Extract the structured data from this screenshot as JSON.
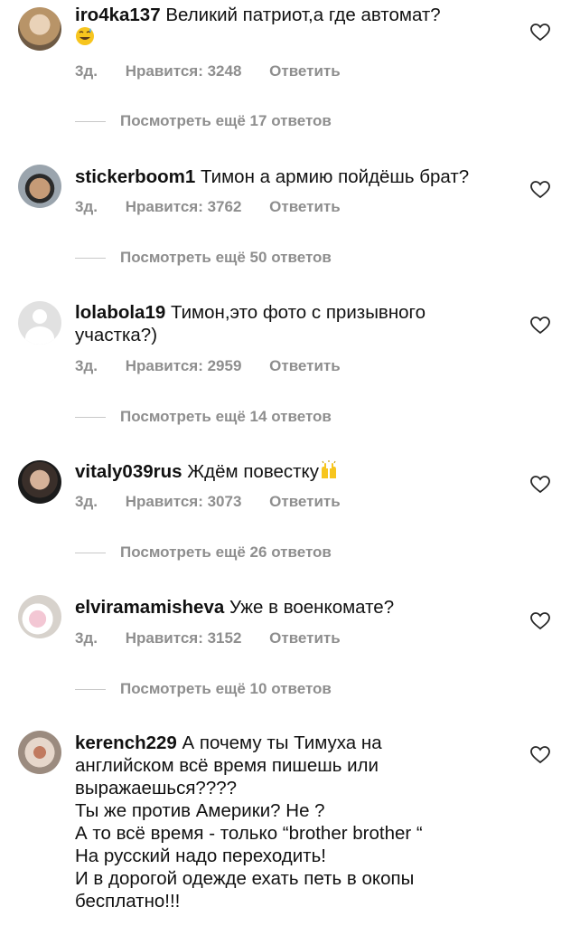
{
  "comments": [
    {
      "username": "iro4ka137",
      "text": "Великий патриот,а где автомат?",
      "emoji": "😅",
      "emoji_name": "grinning-sweat-emoji",
      "time": "3д.",
      "likes": "Нравится: 3248",
      "reply": "Ответить",
      "view_replies": "Посмотреть ещё 17 ответов"
    },
    {
      "username": "stickerboom1",
      "text": "Тимон а армию пойдёшь брат?",
      "time": "3д.",
      "likes": "Нравится: 3762",
      "reply": "Ответить",
      "view_replies": "Посмотреть ещё 50 ответов"
    },
    {
      "username": "lolabola19",
      "text": "Тимон,это фото с призывного участка?)",
      "time": "3д.",
      "likes": "Нравится: 2959",
      "reply": "Ответить",
      "view_replies": "Посмотреть ещё 14 ответов"
    },
    {
      "username": "vitaly039rus",
      "text": "Ждём повестку",
      "emoji": "🙌",
      "emoji_name": "raising-hands-emoji",
      "time": "3д.",
      "likes": "Нравится: 3073",
      "reply": "Ответить",
      "view_replies": "Посмотреть ещё 26 ответов"
    },
    {
      "username": "elviramamisheva",
      "text": "Уже в военкомате?",
      "time": "3д.",
      "likes": "Нравится: 3152",
      "reply": "Ответить",
      "view_replies": "Посмотреть ещё 10 ответов"
    },
    {
      "username": "kerench229",
      "text": "А почему ты Тимуха на английском всё время пишешь или выражаешься????",
      "lines": [
        "Ты же против Америки? Не ?",
        "А то всё время - только “brother brother “",
        "На русский надо переходить!",
        "И в дорогой одежде ехать петь в окопы бесплатно!!!"
      ]
    }
  ],
  "colors": {
    "text": "#111111",
    "meta": "#8e8e8e",
    "divider": "#c8c8c8",
    "background": "#ffffff"
  },
  "icons": {
    "like": "heart-outline-icon"
  }
}
